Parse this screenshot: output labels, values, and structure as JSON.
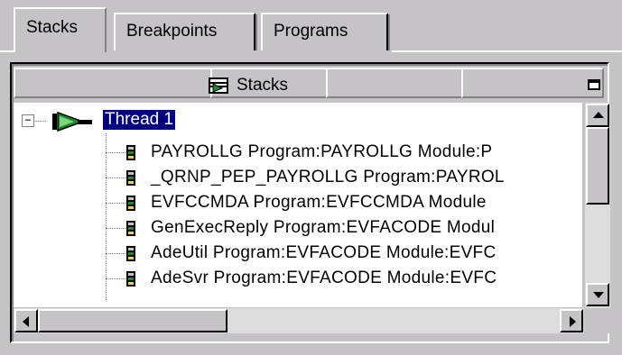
{
  "tabs": [
    {
      "label": "Stacks",
      "active": true
    },
    {
      "label": "Breakpoints",
      "active": false
    },
    {
      "label": "Programs",
      "active": false
    }
  ],
  "panel": {
    "title": "Stacks",
    "title_icon": "stack-view-icon",
    "maximize_icon": "maximize-icon"
  },
  "tree": {
    "thread": {
      "label": "Thread 1",
      "expander": "⊟",
      "icon": "thread-run-icon"
    },
    "frames": [
      {
        "text": "PAYROLLG   Program:PAYROLLG   Module:P",
        "icon": "stack-frame-icon"
      },
      {
        "text": "_QRNP_PEP_PAYROLLG   Program:PAYROL",
        "icon": "stack-frame-icon"
      },
      {
        "text": "EVFCCMDA   Program:EVFCCMDA   Module",
        "icon": "stack-frame-icon"
      },
      {
        "text": "GenExecReply   Program:EVFACODE   Modul",
        "icon": "stack-frame-icon"
      },
      {
        "text": "AdeUtil   Program:EVFACODE   Module:EVFC",
        "icon": "stack-frame-icon"
      },
      {
        "text": "AdeSvr   Program:EVFACODE   Module:EVFC",
        "icon": "stack-frame-icon"
      }
    ]
  },
  "colors": {
    "selection": "#000080",
    "chrome": "#c6c3c6"
  }
}
